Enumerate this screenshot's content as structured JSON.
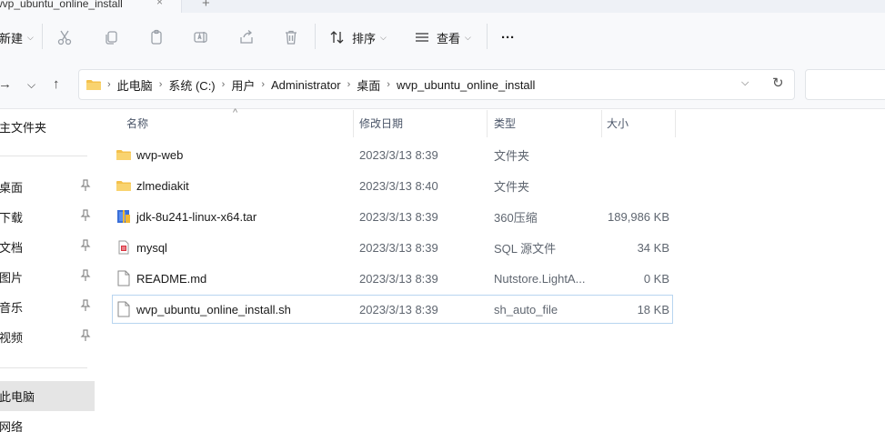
{
  "tab": {
    "title": "wvp_ubuntu_online_install",
    "close": "×",
    "add": "+"
  },
  "toolbar": {
    "new_label": "新建",
    "sort_label": "排序",
    "view_label": "查看",
    "more_label": "···"
  },
  "nav_buttons": {
    "back": "→",
    "dropdown": "⌵",
    "up": "↑"
  },
  "address": {
    "crumbs": [
      "此电脑",
      "系统 (C:)",
      "用户",
      "Administrator",
      "桌面",
      "wvp_ubuntu_online_install"
    ],
    "separator": "›"
  },
  "sidebar": {
    "items": [
      {
        "label": "主文件夹",
        "pinned": false
      },
      {
        "label": "桌面",
        "pinned": true
      },
      {
        "label": "下载",
        "pinned": true
      },
      {
        "label": "文档",
        "pinned": true
      },
      {
        "label": "图片",
        "pinned": true
      },
      {
        "label": "音乐",
        "pinned": true
      },
      {
        "label": "视频",
        "pinned": true
      },
      {
        "label": "此电脑",
        "pinned": false,
        "selected": true
      },
      {
        "label": "网络",
        "pinned": false
      }
    ]
  },
  "columns": {
    "name": "名称",
    "date": "修改日期",
    "type": "类型",
    "size": "大小"
  },
  "files": [
    {
      "name": "wvp-web",
      "date": "2023/3/13 8:39",
      "type": "文件夹",
      "size": "",
      "icon": "folder-icon"
    },
    {
      "name": "zlmediakit",
      "date": "2023/3/13 8:40",
      "type": "文件夹",
      "size": "",
      "icon": "folder-icon"
    },
    {
      "name": "jdk-8u241-linux-x64.tar",
      "date": "2023/3/13 8:39",
      "type": "360压缩",
      "size": "189,986 KB",
      "icon": "archive-icon"
    },
    {
      "name": "mysql",
      "date": "2023/3/13 8:39",
      "type": "SQL 源文件",
      "size": "34 KB",
      "icon": "sql-file-icon"
    },
    {
      "name": "README.md",
      "date": "2023/3/13 8:39",
      "type": "Nutstore.LightA...",
      "size": "0 KB",
      "icon": "file-icon"
    },
    {
      "name": "wvp_ubuntu_online_install.sh",
      "date": "2023/3/13 8:39",
      "type": "sh_auto_file",
      "size": "18 KB",
      "icon": "file-icon",
      "focused": true
    }
  ],
  "colors": {
    "folder": "#f4c14c",
    "accent": "#b8d5f0",
    "selected_bg": "#e5e5e5"
  }
}
